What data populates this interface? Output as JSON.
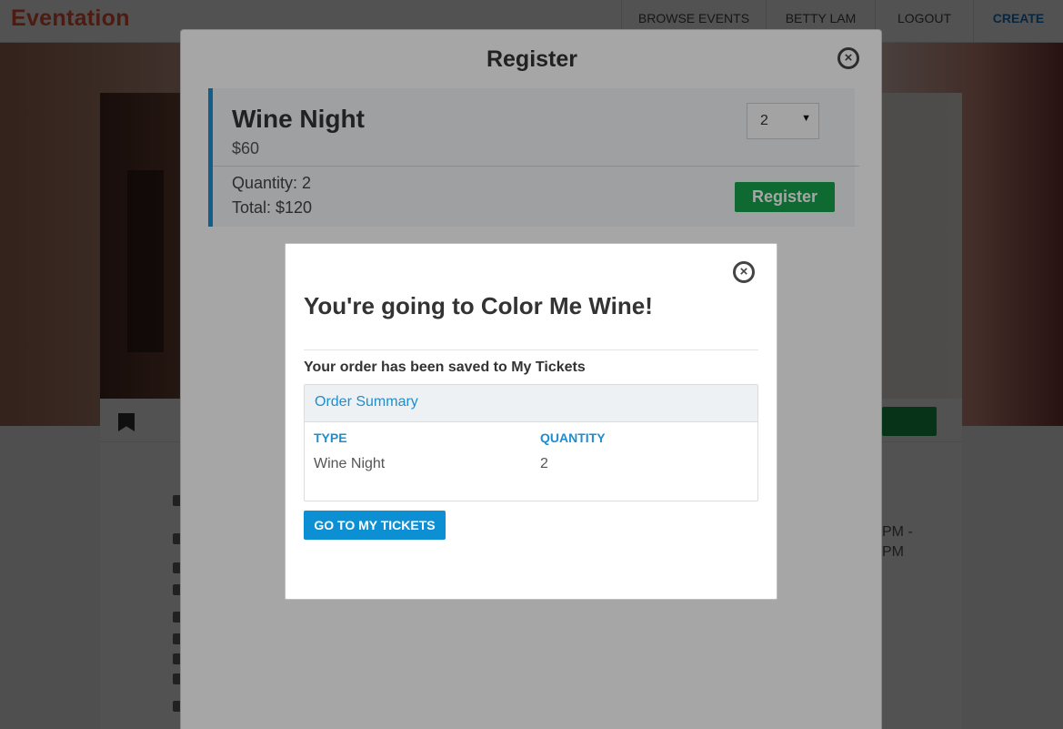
{
  "navbar": {
    "logo": "Eventation",
    "items": [
      {
        "label": "BROWSE EVENTS"
      },
      {
        "label": "BETTY LAM"
      },
      {
        "label": "LOGOUT"
      },
      {
        "label": "CREATE"
      }
    ]
  },
  "event_page": {
    "time_line1": "PM -",
    "time_line2": "PM"
  },
  "register_modal": {
    "title": "Register",
    "ticket": {
      "name": "Wine Night",
      "price": "$60",
      "selected_quantity": "2",
      "quantity_line": "Quantity: 2",
      "total_line": "Total: $120",
      "register_label": "Register"
    }
  },
  "confirm_modal": {
    "title": "You're going to Color Me Wine!",
    "saved_message": "Your order has been saved to My Tickets",
    "summary": {
      "title": "Order Summary",
      "columns": [
        "TYPE",
        "QUANTITY"
      ],
      "rows": [
        {
          "type": "Wine Night",
          "quantity": "2"
        }
      ]
    },
    "button_label": "GO TO MY TICKETS"
  },
  "colors": {
    "brand": "#f05537",
    "accent": "#1d8ed0",
    "success": "#16a34a"
  },
  "icons": [
    "close-icon",
    "bookmark-icon",
    "chevron-down-icon"
  ]
}
